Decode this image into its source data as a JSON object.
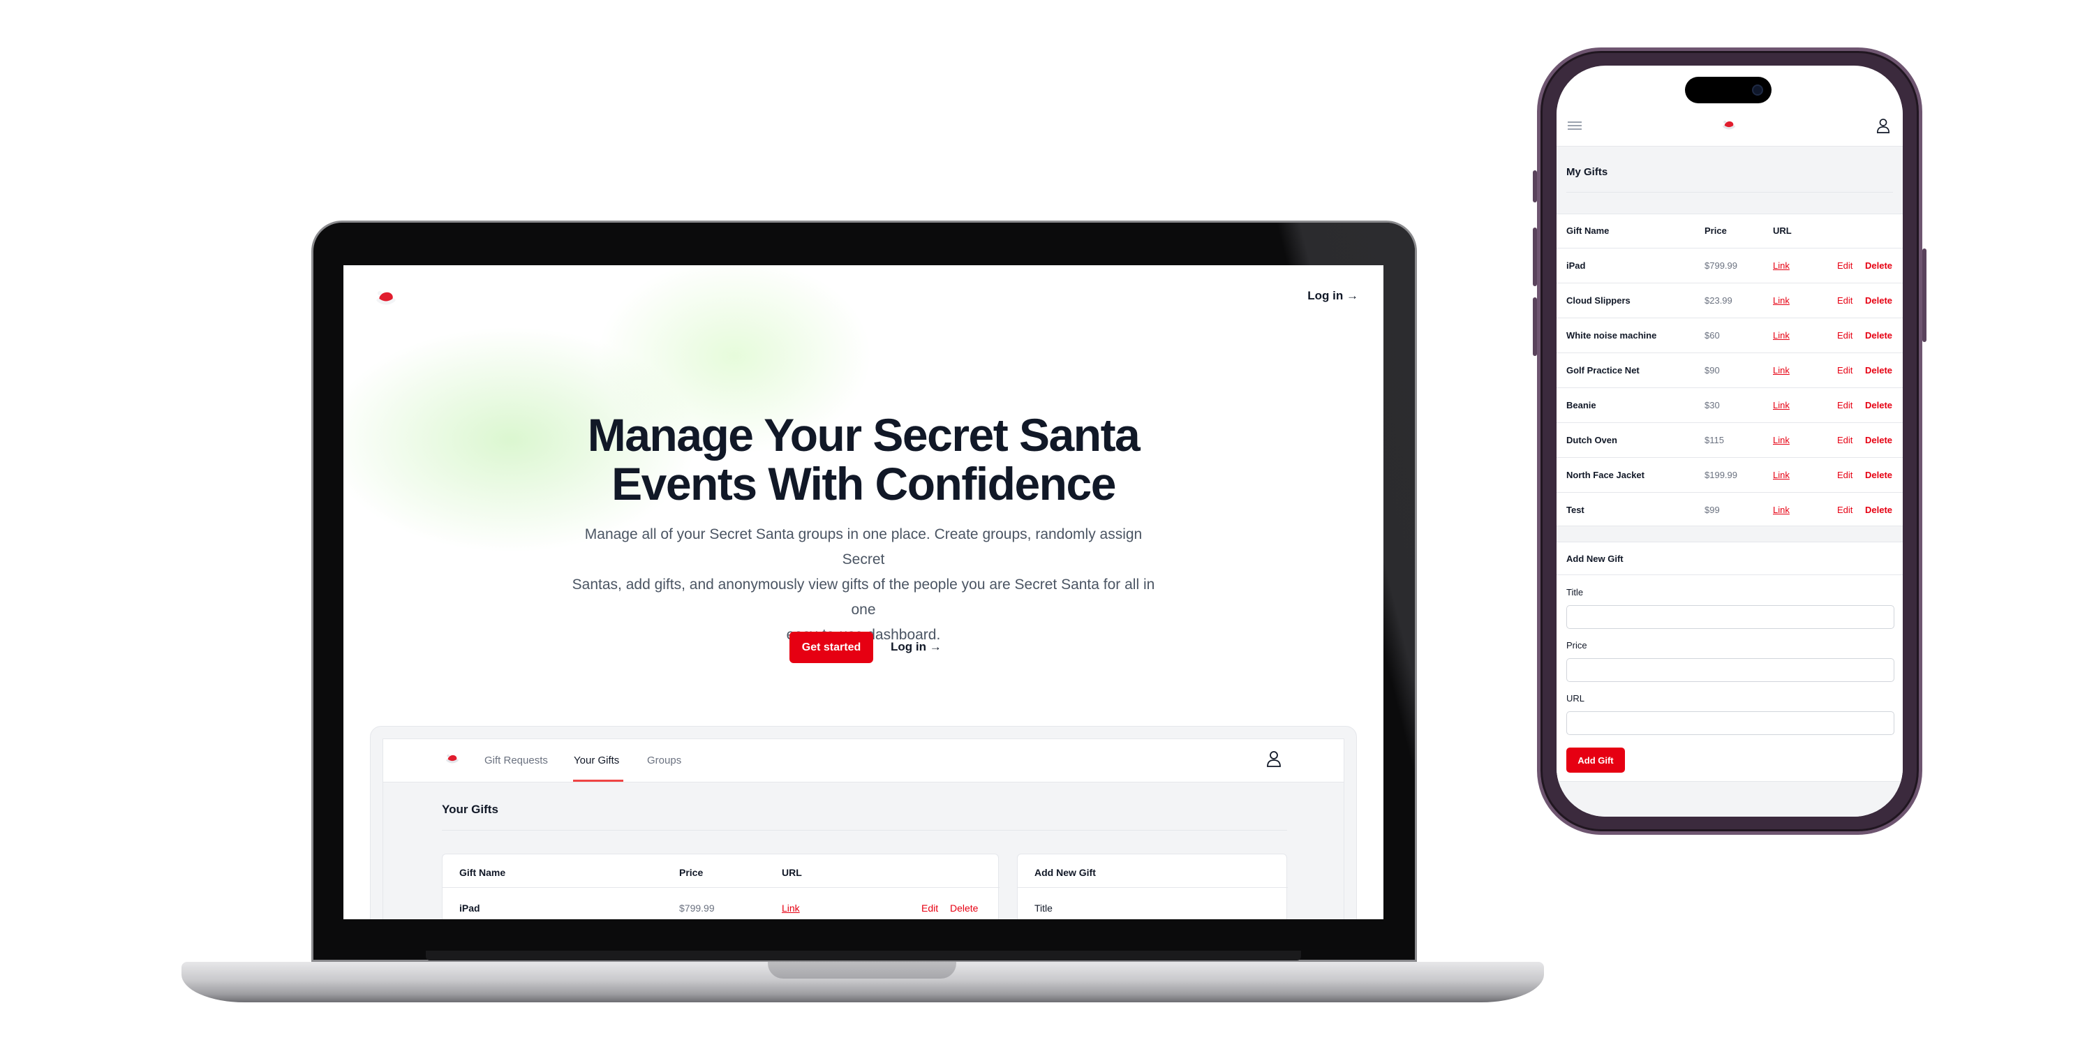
{
  "laptop": {
    "nav": {
      "login": "Log in →"
    },
    "hero": {
      "title_line1": "Manage Your Secret Santa",
      "title_line2": "Events With Confidence",
      "desc_line1": "Manage all of your Secret Santa groups in one place. Create groups, randomly assign Secret",
      "desc_line2": "Santas, add gifts, and anonymously view gifts of the people you are Secret Santa for all in one",
      "desc_line3": "easy-to-use dashboard.",
      "cta_primary": "Get started",
      "cta_secondary": "Log in →"
    },
    "dashboard": {
      "tabs": [
        "Gift Requests",
        "Your Gifts",
        "Groups"
      ],
      "active_tab": "Your Gifts",
      "heading": "Your Gifts",
      "columns": [
        "Gift Name",
        "Price",
        "URL"
      ],
      "rows": [
        {
          "name": "iPad",
          "price": "$799.99",
          "url": "Link",
          "edit": "Edit",
          "delete": "Delete"
        }
      ],
      "form": {
        "title": "Add New Gift",
        "first_label": "Title"
      }
    }
  },
  "phone": {
    "title": "My Gifts",
    "columns": [
      "Gift Name",
      "Price",
      "URL"
    ],
    "rows": [
      {
        "name": "iPad",
        "price": "$799.99",
        "url": "Link",
        "edit": "Edit",
        "delete": "Delete"
      },
      {
        "name": "Cloud Slippers",
        "price": "$23.99",
        "url": "Link",
        "edit": "Edit",
        "delete": "Delete"
      },
      {
        "name": "White noise machine",
        "price": "$60",
        "url": "Link",
        "edit": "Edit",
        "delete": "Delete"
      },
      {
        "name": "Golf Practice Net",
        "price": "$90",
        "url": "Link",
        "edit": "Edit",
        "delete": "Delete"
      },
      {
        "name": "Beanie",
        "price": "$30",
        "url": "Link",
        "edit": "Edit",
        "delete": "Delete"
      },
      {
        "name": "Dutch Oven",
        "price": "$115",
        "url": "Link",
        "edit": "Edit",
        "delete": "Delete"
      },
      {
        "name": "North Face Jacket",
        "price": "$199.99",
        "url": "Link",
        "edit": "Edit",
        "delete": "Delete"
      },
      {
        "name": "Test",
        "price": "$99",
        "url": "Link",
        "edit": "Edit",
        "delete": "Delete"
      }
    ],
    "form": {
      "title": "Add New Gift",
      "title_label": "Title",
      "price_label": "Price",
      "url_label": "URL",
      "title_value": "",
      "price_value": "",
      "url_value": "",
      "submit": "Add Gift"
    }
  },
  "colors": {
    "accent": "#e60012",
    "text": "#111827",
    "muted": "#6b7280",
    "phone_frame": "#6e5570"
  },
  "icons": {
    "logo": "santa-hat-icon",
    "user": "user-icon",
    "menu": "hamburger-menu-icon"
  }
}
